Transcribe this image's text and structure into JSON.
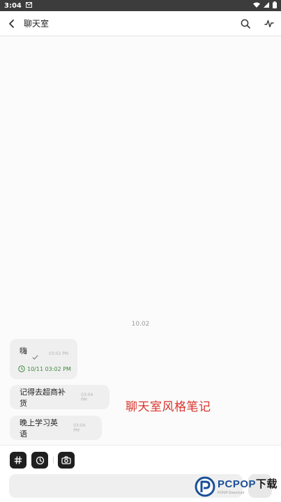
{
  "status_bar": {
    "time": "3:04",
    "mail_icon": "M",
    "icons": [
      "wifi-icon",
      "signal-icon",
      "battery-icon"
    ]
  },
  "header": {
    "title": "聊天室"
  },
  "chat": {
    "date_divider": "10.02",
    "messages": [
      {
        "text": "嗨",
        "time": "03:02 PM",
        "status": "sent-check-icon",
        "reminder": "10/11 03:02 PM"
      },
      {
        "text": "记得去超商补货",
        "time": "03:04 PM"
      },
      {
        "text": "晚上学习英语",
        "time": "03:04 PM"
      }
    ]
  },
  "watermark": {
    "text": "聊天室风格笔记"
  },
  "toolbar": {
    "buttons": [
      "hashtag-icon",
      "clock-icon",
      "camera-icon"
    ]
  },
  "input": {
    "placeholder": ""
  },
  "logo": {
    "name": "PCPOP",
    "suffix": "下载",
    "sub": "PCPOP Download"
  },
  "colors": {
    "accent_green": "#3f8a3f",
    "watermark_red": "#d9342b",
    "logo_blue": "#1a4f96",
    "bubble": "#efefef"
  }
}
